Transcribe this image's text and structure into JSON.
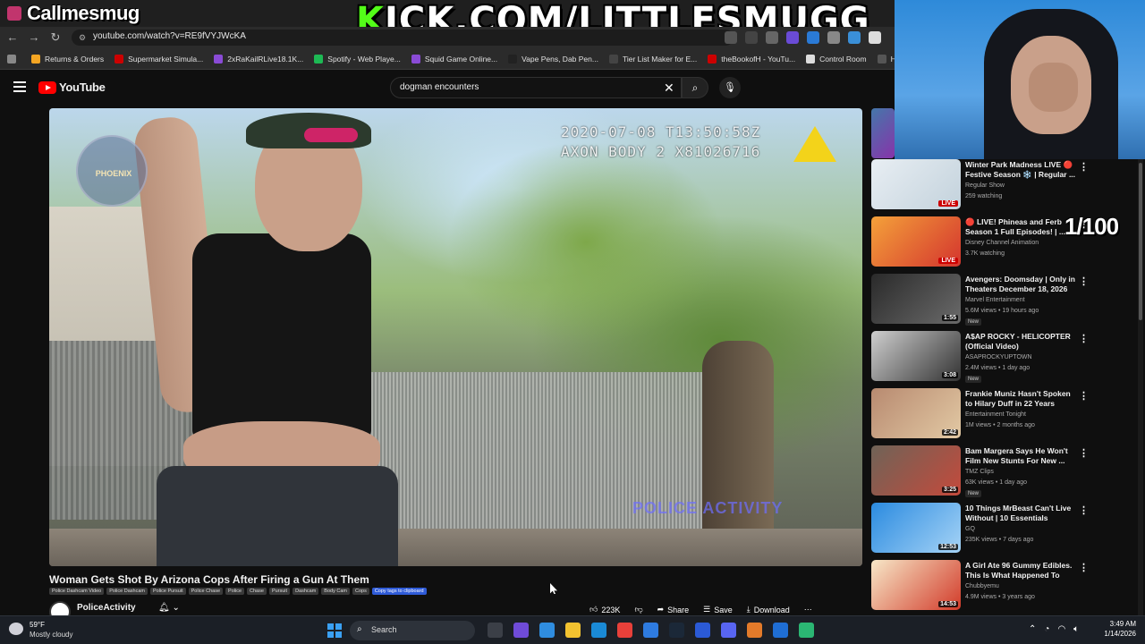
{
  "overlay": {
    "streamer_name": "Callmesmug",
    "kick_k": "K",
    "kick_rest": "ICK.COM/LITTLESMUGG",
    "counter": "1/100"
  },
  "browser": {
    "url": "youtube.com/watch?v=RE9fVYJWcKA",
    "bookmarks": [
      {
        "label": "Returns & Orders",
        "color": "#f5a623"
      },
      {
        "label": "Supermarket Simula...",
        "color": "#cc0000"
      },
      {
        "label": "2xRaKailRLive18.1K...",
        "color": "#8a4bd6"
      },
      {
        "label": "Spotify - Web Playe...",
        "color": "#1db954"
      },
      {
        "label": "Squid Game Online...",
        "color": "#8a4bd6"
      },
      {
        "label": "Vape Pens, Dab Pen...",
        "color": "#222222"
      },
      {
        "label": "Tier List Maker for E...",
        "color": "#444444"
      },
      {
        "label": "theBookofH - YouTu...",
        "color": "#cc0000"
      },
      {
        "label": "Control Room",
        "color": "#dddddd"
      },
      {
        "label": "Home",
        "color": "#555555"
      }
    ]
  },
  "youtube": {
    "logo_text": "YouTube",
    "search_value": "dogman encounters"
  },
  "video": {
    "timestamp_line1": "2020-07-08 T13:50:58Z",
    "timestamp_line2": "AXON BODY 2 X81026716",
    "badge_text": "PHOENIX",
    "watermark": "POLICE ACTIVITY",
    "title": "Woman Gets Shot By Arizona Cops After Firing a Gun At Them",
    "tags": [
      "Police Dashcam Video",
      "Police Dashcam",
      "Police Pursuit",
      "Police Chase",
      "Police",
      "Chase",
      "Pursuit",
      "Dashcam",
      "Body Cam",
      "Cops"
    ],
    "copy_tags_label": "Copy tags to clipboard",
    "channel": "PoliceActivity",
    "likes": "223K",
    "share_label": "Share",
    "save_label": "Save",
    "download_label": "Download"
  },
  "recommendations": [
    {
      "title": "Winter Park Madness LIVE 🔴 Festive Season ❄️ | Regular ...",
      "channel": "Regular Show",
      "meta": "259 watching",
      "badge": "LIVE",
      "is_live": true,
      "new": false,
      "colors": [
        "#e8eef3",
        "#c3d2dc"
      ]
    },
    {
      "title": "🔴 LIVE! Phineas and Ferb Season 1 Full Episodes! | ...",
      "channel": "Disney Channel Animation",
      "meta": "3.7K watching",
      "badge": "LIVE",
      "is_live": true,
      "new": false,
      "colors": [
        "#f4a13a",
        "#d4352e"
      ]
    },
    {
      "title": "Avengers: Doomsday | Only in Theaters December 18, 2026",
      "channel": "Marvel Entertainment",
      "meta": "5.6M views • 19 hours ago",
      "badge": "1:55",
      "is_live": false,
      "new": true,
      "colors": [
        "#2a2a2a",
        "#6a6a6a"
      ]
    },
    {
      "title": "A$AP ROCKY - HELICOPTER (Official Video)",
      "channel": "ASAPROCKYUPTOWN",
      "meta": "2.4M views • 1 day ago",
      "badge": "3:08",
      "is_live": false,
      "new": true,
      "colors": [
        "#cfcfcf",
        "#333333"
      ]
    },
    {
      "title": "Frankie Muniz Hasn't Spoken to Hilary Duff in 22 Years Becaus...",
      "channel": "Entertainment Tonight",
      "meta": "1M views • 2 months ago",
      "badge": "2:42",
      "is_live": false,
      "new": false,
      "colors": [
        "#b88a70",
        "#e2c9a4"
      ]
    },
    {
      "title": "Bam Margera Says He Won't Film New Stunts For New ...",
      "channel": "TMZ Clips",
      "meta": "63K views • 1 day ago",
      "badge": "3:25",
      "is_live": false,
      "new": true,
      "colors": [
        "#6f6357",
        "#c44a3c"
      ]
    },
    {
      "title": "10 Things MrBeast Can't Live Without | 10 Essentials",
      "channel": "GQ",
      "meta": "235K views • 7 days ago",
      "badge": "12:53",
      "is_live": false,
      "new": false,
      "colors": [
        "#2b8be0",
        "#a5d3f6"
      ]
    },
    {
      "title": "A Girl Ate 96 Gummy Edibles. This Is What Happened To Her...",
      "channel": "Chubbyemu",
      "meta": "4.9M views • 3 years ago",
      "badge": "14:53",
      "is_live": false,
      "new": false,
      "colors": [
        "#f7e8c8",
        "#d23b2a"
      ]
    }
  ],
  "taskbar": {
    "temp": "59°F",
    "weather": "Mostly cloudy",
    "search_label": "Search",
    "time": "3:49 AM",
    "date": "1/14/2026",
    "icons": [
      "#3b3f47",
      "#6f4bd8",
      "#2f8de0",
      "#f2c230",
      "#1a8ad6",
      "#e8403a",
      "#2e7be0",
      "#1b2838",
      "#2b5ad6",
      "#5865f2",
      "#e37a2a",
      "#1f6ed4",
      "#2bb673"
    ]
  }
}
